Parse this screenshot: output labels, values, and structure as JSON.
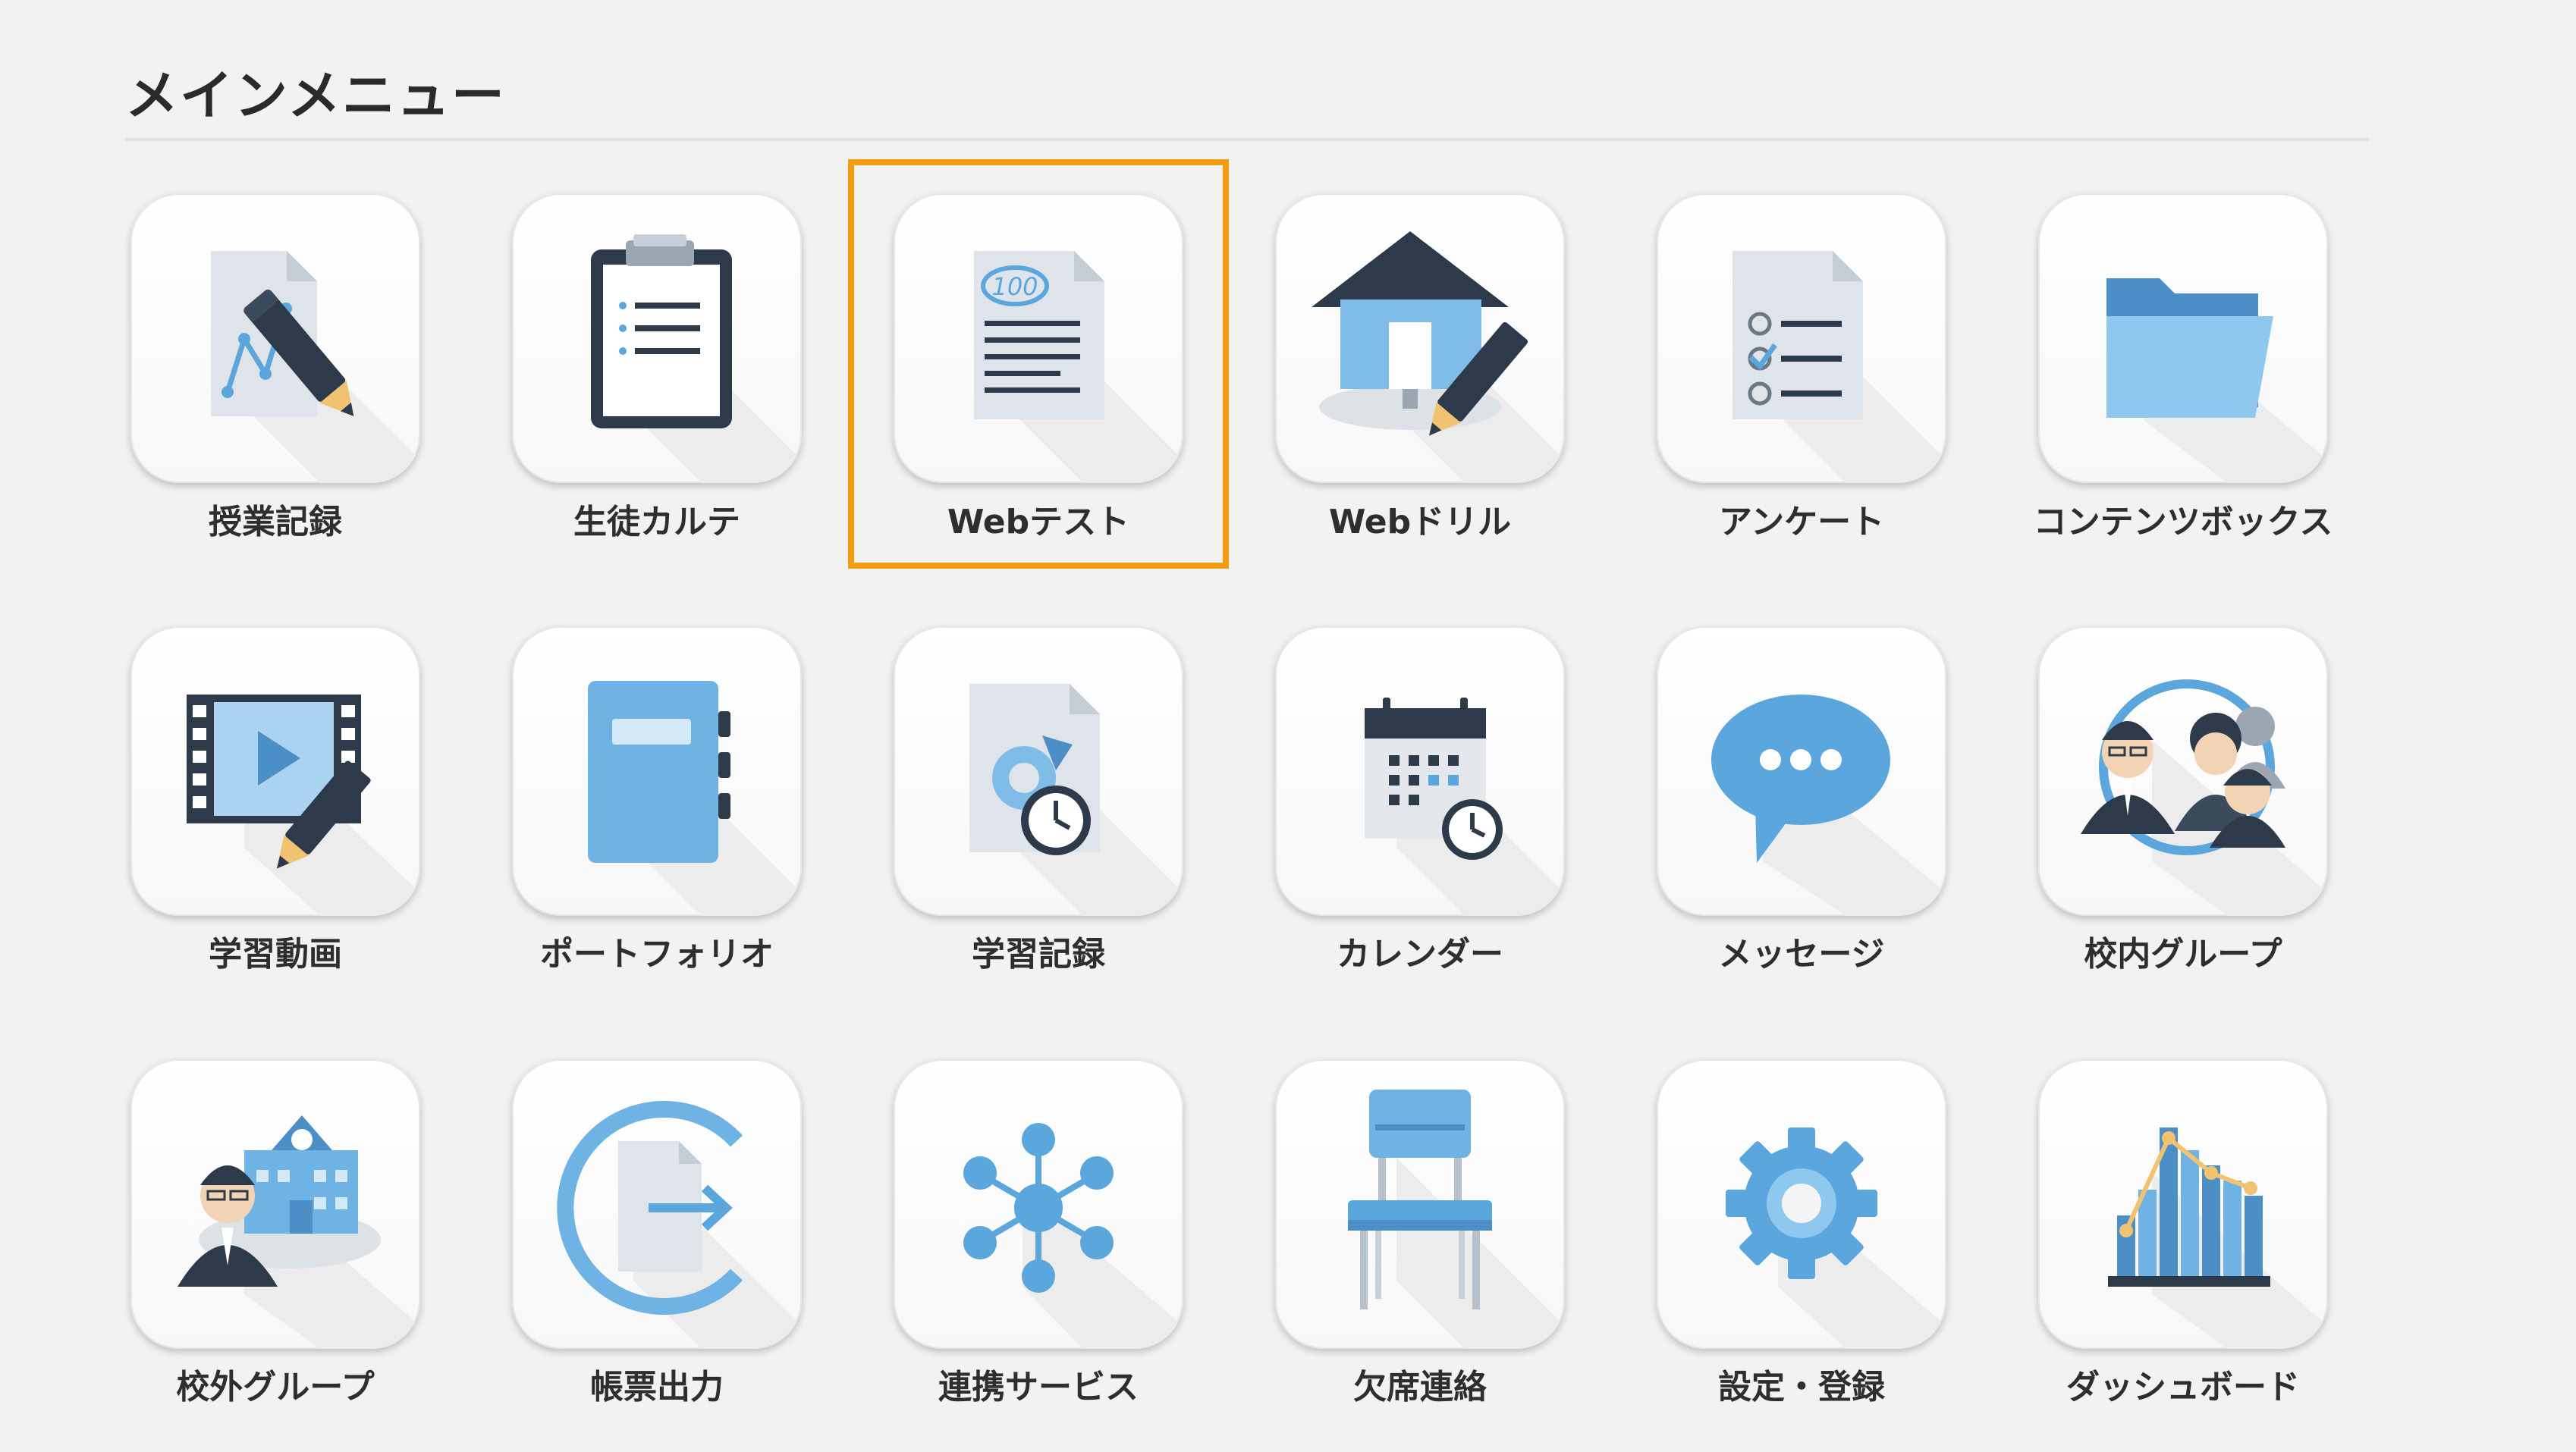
{
  "menu": {
    "title": "メインメニュー",
    "items": [
      {
        "label": "授業記録",
        "icon": "lesson-record-icon"
      },
      {
        "label": "生徒カルテ",
        "icon": "clipboard-icon"
      },
      {
        "label": "Webテスト",
        "icon": "test-sheet-icon",
        "highlighted": true
      },
      {
        "label": "Webドリル",
        "icon": "home-pencil-icon"
      },
      {
        "label": "アンケート",
        "icon": "checklist-icon"
      },
      {
        "label": "コンテンツボックス",
        "icon": "folder-icon"
      },
      {
        "label": "学習動画",
        "icon": "video-pencil-icon"
      },
      {
        "label": "ポートフォリオ",
        "icon": "notebook-icon"
      },
      {
        "label": "学習記録",
        "icon": "document-clock-icon"
      },
      {
        "label": "カレンダー",
        "icon": "calendar-icon"
      },
      {
        "label": "メッセージ",
        "icon": "speech-bubble-icon"
      },
      {
        "label": "校内グループ",
        "icon": "people-group-icon"
      },
      {
        "label": "校外グループ",
        "icon": "school-person-icon"
      },
      {
        "label": "帳票出力",
        "icon": "export-document-icon"
      },
      {
        "label": "連携サービス",
        "icon": "network-icon"
      },
      {
        "label": "欠席連絡",
        "icon": "chair-icon"
      },
      {
        "label": "設定・登録",
        "icon": "gear-icon"
      },
      {
        "label": "ダッシュボード",
        "icon": "bar-chart-icon"
      }
    ]
  },
  "colors": {
    "accent_blue": "#5ba6dc",
    "dark_navy": "#2c3a4a",
    "highlight": "#f39c12"
  }
}
